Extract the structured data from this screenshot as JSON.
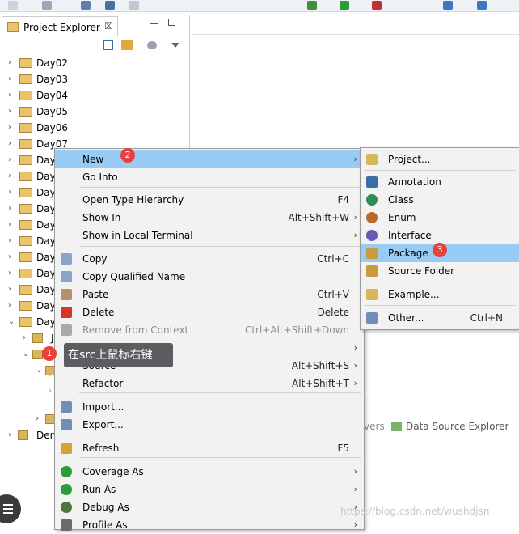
{
  "explorer": {
    "title": "Project Explorer",
    "close_glyph": "☒",
    "projects": [
      "Day02",
      "Day03",
      "Day04",
      "Day05",
      "Day06",
      "Day07",
      "Day",
      "Day",
      "Day",
      "Day",
      "Day",
      "Day",
      "Day",
      "Day",
      "Day",
      "Day",
      "Day"
    ],
    "row_j": "J",
    "row_demo": "Dem"
  },
  "context_menu": {
    "items": [
      {
        "label": "New",
        "accel": "",
        "submenu": true
      },
      {
        "label": "Go Into",
        "accel": "",
        "submenu": false
      },
      {
        "label": "Open Type Hierarchy",
        "accel": "F4",
        "submenu": false
      },
      {
        "label": "Show In",
        "accel": "Alt+Shift+W",
        "submenu": true
      },
      {
        "label": "Show in Local Terminal",
        "accel": "",
        "submenu": true
      },
      {
        "label": "Copy",
        "accel": "Ctrl+C",
        "submenu": false
      },
      {
        "label": "Copy Qualified Name",
        "accel": "",
        "submenu": false
      },
      {
        "label": "Paste",
        "accel": "Ctrl+V",
        "submenu": false
      },
      {
        "label": "Delete",
        "accel": "Delete",
        "submenu": false
      },
      {
        "label": "Remove from Context",
        "accel": "Ctrl+Alt+Shift+Down",
        "submenu": false
      },
      {
        "label": "Build Path",
        "accel": "",
        "submenu": true
      },
      {
        "label": "Source",
        "accel": "Alt+Shift+S",
        "submenu": true
      },
      {
        "label": "Refactor",
        "accel": "Alt+Shift+T",
        "submenu": true
      },
      {
        "label": "Import...",
        "accel": "",
        "submenu": false
      },
      {
        "label": "Export...",
        "accel": "",
        "submenu": false
      },
      {
        "label": "Refresh",
        "accel": "F5",
        "submenu": false
      },
      {
        "label": "Coverage As",
        "accel": "",
        "submenu": true
      },
      {
        "label": "Run As",
        "accel": "",
        "submenu": true
      },
      {
        "label": "Debug As",
        "accel": "",
        "submenu": true
      },
      {
        "label": "Profile As",
        "accel": "",
        "submenu": true
      }
    ],
    "arrow_glyph": "›"
  },
  "new_submenu": {
    "items": [
      {
        "label": "Project...",
        "accel": ""
      },
      {
        "label": "Annotation",
        "accel": ""
      },
      {
        "label": "Class",
        "accel": ""
      },
      {
        "label": "Enum",
        "accel": ""
      },
      {
        "label": "Interface",
        "accel": ""
      },
      {
        "label": "Package",
        "accel": ""
      },
      {
        "label": "Source Folder",
        "accel": ""
      },
      {
        "label": "Example...",
        "accel": ""
      },
      {
        "label": "Other...",
        "accel": "Ctrl+N"
      }
    ]
  },
  "badges": {
    "one": "1",
    "two": "2",
    "three": "3"
  },
  "tooltip": "在src上鼠标右键",
  "bottom_panel": {
    "partial_tab": "vers",
    "tab": "Data Source Explorer"
  },
  "watermark": "https://blog.csdn.net/wushdjsn",
  "colors": {
    "highlight": "#99ccf4",
    "badge": "#e8413c",
    "tooltip_bg": "#5b5d61"
  }
}
